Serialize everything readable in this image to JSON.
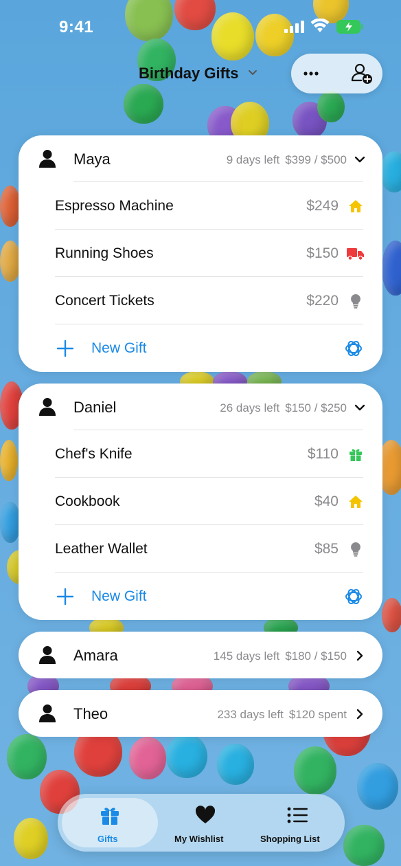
{
  "status_bar": {
    "time": "9:41"
  },
  "header": {
    "title": "Birthday Gifts"
  },
  "people": [
    {
      "name": "Maya",
      "days_left": "9 days left",
      "budget": "$399 / $500",
      "expanded": true,
      "gifts": [
        {
          "name": "Espresso Machine",
          "price": "$249",
          "status_icon": "house-icon",
          "status_color": "#f5c400"
        },
        {
          "name": "Running Shoes",
          "price": "$150",
          "status_icon": "truck-icon",
          "status_color": "#ee3b3b"
        },
        {
          "name": "Concert Tickets",
          "price": "$220",
          "status_icon": "lightbulb-icon",
          "status_color": "#8a8a8e"
        }
      ],
      "new_gift_label": "New Gift"
    },
    {
      "name": "Daniel",
      "days_left": "26 days left",
      "budget": "$150 / $250",
      "expanded": true,
      "gifts": [
        {
          "name": "Chef's Knife",
          "price": "$110",
          "status_icon": "gift-icon",
          "status_color": "#34c759"
        },
        {
          "name": "Cookbook",
          "price": "$40",
          "status_icon": "house-icon",
          "status_color": "#f5c400"
        },
        {
          "name": "Leather Wallet",
          "price": "$85",
          "status_icon": "lightbulb-icon",
          "status_color": "#8a8a8e"
        }
      ],
      "new_gift_label": "New Gift"
    },
    {
      "name": "Amara",
      "days_left": "145 days left",
      "budget": "$180 / $150",
      "expanded": false
    },
    {
      "name": "Theo",
      "days_left": "233 days left",
      "budget": "$120 spent",
      "expanded": false
    }
  ],
  "tab_bar": {
    "tabs": [
      {
        "label": "Gifts",
        "icon": "gift-icon",
        "active": true
      },
      {
        "label": "My Wishlist",
        "icon": "heart-icon",
        "active": false
      },
      {
        "label": "Shopping List",
        "icon": "list-icon",
        "active": false
      }
    ]
  },
  "colors": {
    "accent": "#1a8ae6",
    "secondary_text": "#8a8a8e",
    "battery": "#34c759"
  }
}
